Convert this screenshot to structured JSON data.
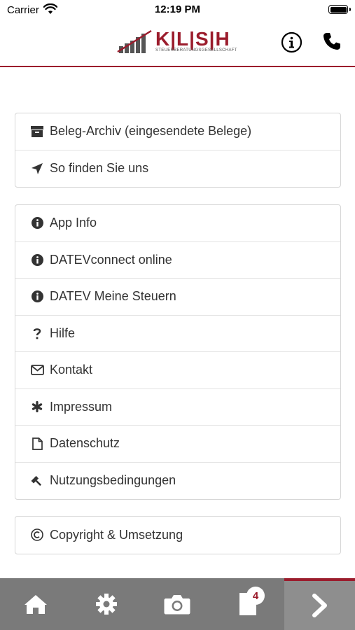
{
  "status_bar": {
    "carrier": "Carrier",
    "time": "12:19 PM"
  },
  "header": {
    "logo_text": "K|L|S|H",
    "logo_subtitle": "STEUERBERATUNGSGESELLSCHAFT"
  },
  "menu_group_1": [
    {
      "label": "Beleg-Archiv (eingesendete Belege)",
      "icon": "archive-icon"
    },
    {
      "label": "So finden Sie uns",
      "icon": "location-arrow-icon"
    }
  ],
  "menu_group_2": [
    {
      "label": "App Info",
      "icon": "info-circle-icon"
    },
    {
      "label": "DATEVconnect online",
      "icon": "info-circle-icon"
    },
    {
      "label": "DATEV Meine Steuern",
      "icon": "info-circle-icon"
    },
    {
      "label": "Hilfe",
      "icon": "question-icon"
    },
    {
      "label": "Kontakt",
      "icon": "envelope-icon"
    },
    {
      "label": "Impressum",
      "icon": "asterisk-icon"
    },
    {
      "label": "Datenschutz",
      "icon": "file-icon"
    },
    {
      "label": "Nutzungsbedingungen",
      "icon": "gavel-icon"
    }
  ],
  "menu_group_3": [
    {
      "label": "Copyright & Umsetzung",
      "icon": "copyright-icon"
    }
  ],
  "tabbar": {
    "items": [
      "home-icon",
      "settings-icon",
      "camera-icon",
      "documents-icon",
      "next-icon"
    ],
    "documents_badge": "4"
  },
  "colors": {
    "accent": "#9b1c2c",
    "tabbar": "#7a7a7a"
  }
}
